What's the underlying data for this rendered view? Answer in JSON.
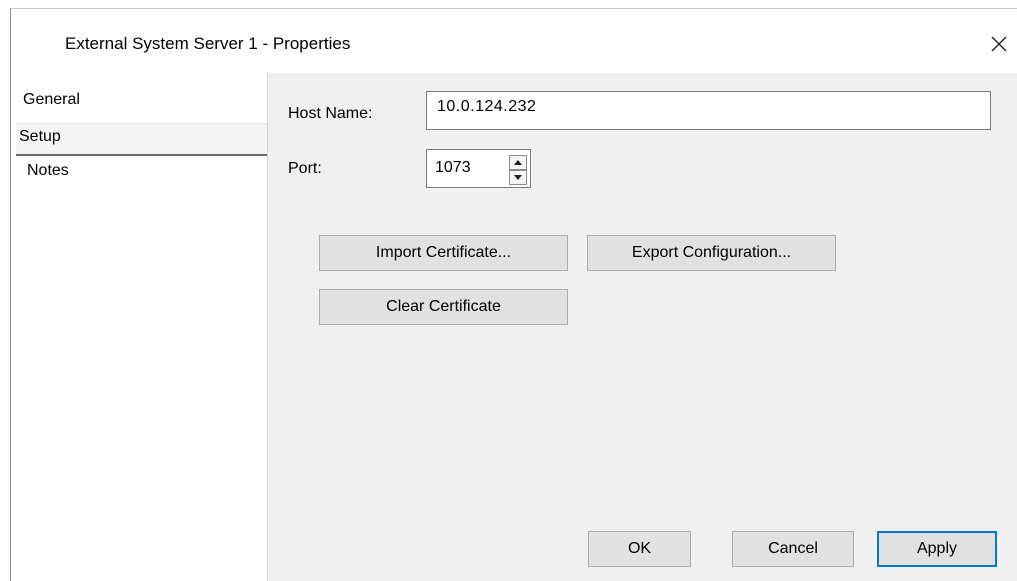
{
  "window": {
    "title": "External System Server 1 - Properties"
  },
  "sidebar": {
    "items": [
      {
        "label": "General"
      },
      {
        "label": "Setup"
      },
      {
        "label": "Notes"
      }
    ],
    "selected": "Setup"
  },
  "setup": {
    "host_name_label": "Host Name:",
    "host_name_value": "10.0.124.232",
    "port_label": "Port:",
    "port_value": "1073"
  },
  "buttons": {
    "import_certificate": "Import Certificate...",
    "export_configuration": "Export Configuration...",
    "clear_certificate": "Clear Certificate",
    "ok": "OK",
    "cancel": "Cancel",
    "apply": "Apply"
  },
  "colors": {
    "default_button_border": "#0078d7",
    "dialog_background": "#f0f0f0"
  },
  "icons": {
    "close": "close-icon",
    "spin_up": "spin-up-icon",
    "spin_down": "spin-down-icon"
  }
}
